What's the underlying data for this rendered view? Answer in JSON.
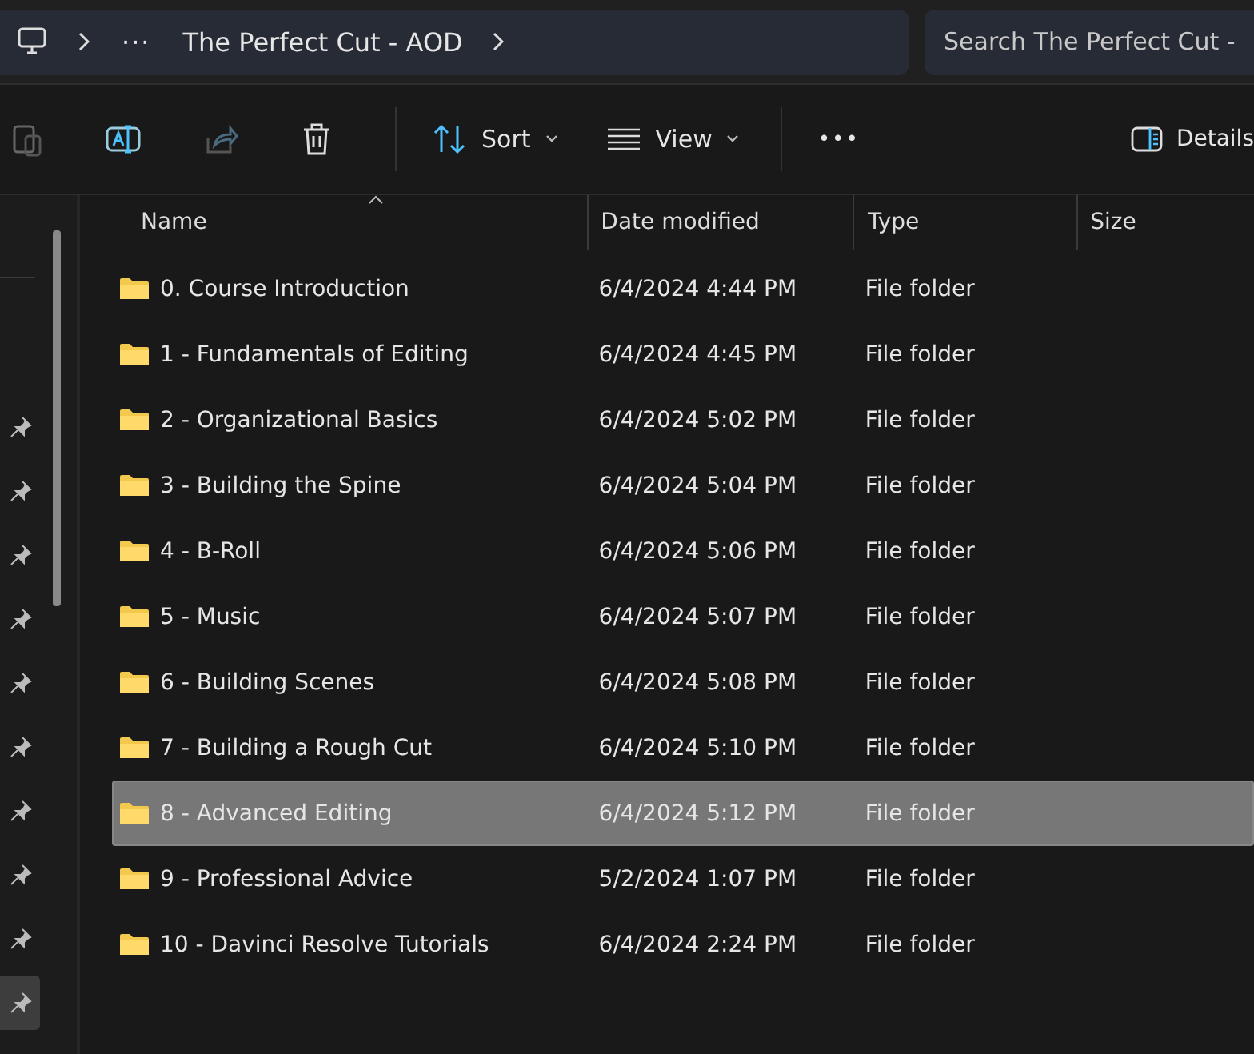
{
  "address_bar": {
    "path_overflow": "···",
    "current_folder": "The Perfect Cut - AOD"
  },
  "search": {
    "placeholder": "Search The Perfect Cut -"
  },
  "toolbar": {
    "sort_label": "Sort",
    "view_label": "View",
    "more_label": "•••",
    "details_label": "Details"
  },
  "sidebar": {
    "pins": [
      {
        "selected": false
      },
      {
        "selected": false
      },
      {
        "selected": false
      },
      {
        "selected": false
      },
      {
        "selected": false
      },
      {
        "selected": false
      },
      {
        "selected": false
      },
      {
        "selected": false
      },
      {
        "selected": false
      },
      {
        "selected": true
      }
    ]
  },
  "table": {
    "columns": [
      "Name",
      "Date modified",
      "Type",
      "Size"
    ],
    "rows": [
      {
        "name": "0. Course Introduction",
        "date": "6/4/2024 4:44 PM",
        "type": "File folder",
        "selected": false
      },
      {
        "name": "1 - Fundamentals of Editing",
        "date": "6/4/2024 4:45 PM",
        "type": "File folder",
        "selected": false
      },
      {
        "name": "2 - Organizational Basics",
        "date": "6/4/2024 5:02 PM",
        "type": "File folder",
        "selected": false
      },
      {
        "name": "3 - Building the Spine",
        "date": "6/4/2024 5:04 PM",
        "type": "File folder",
        "selected": false
      },
      {
        "name": "4 - B-Roll",
        "date": "6/4/2024 5:06 PM",
        "type": "File folder",
        "selected": false
      },
      {
        "name": "5 - Music",
        "date": "6/4/2024 5:07 PM",
        "type": "File folder",
        "selected": false
      },
      {
        "name": "6 - Building Scenes",
        "date": "6/4/2024 5:08 PM",
        "type": "File folder",
        "selected": false
      },
      {
        "name": "7 - Building a Rough Cut",
        "date": "6/4/2024 5:10 PM",
        "type": "File folder",
        "selected": false
      },
      {
        "name": "8 - Advanced Editing",
        "date": "6/4/2024 5:12 PM",
        "type": "File folder",
        "selected": true
      },
      {
        "name": "9 - Professional Advice",
        "date": "5/2/2024 1:07 PM",
        "type": "File folder",
        "selected": false
      },
      {
        "name": "10 - Davinci Resolve Tutorials",
        "date": "6/4/2024 2:24 PM",
        "type": "File folder",
        "selected": false
      }
    ]
  }
}
